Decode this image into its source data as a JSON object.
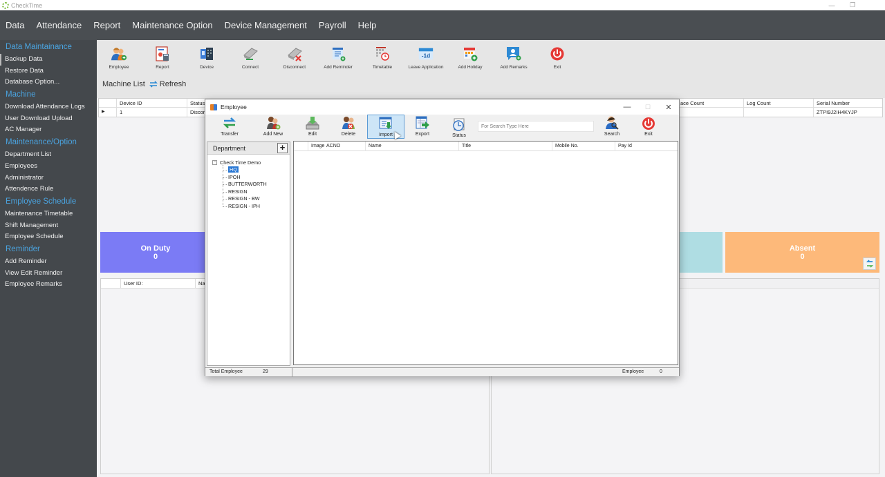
{
  "window": {
    "app_title": "CheckTime",
    "controls": {
      "minimize": "—",
      "restore": "❐",
      "close": "✕"
    }
  },
  "menu": [
    "Data",
    "Attendance",
    "Report",
    "Maintenance Option",
    "Device Management",
    "Payroll",
    "Help"
  ],
  "sidebar": [
    {
      "type": "section",
      "label": "Data Maintainance"
    },
    {
      "type": "item",
      "label": "Backup Data",
      "active": true
    },
    {
      "type": "item",
      "label": "Restore Data"
    },
    {
      "type": "item",
      "label": "Database Option..."
    },
    {
      "type": "section",
      "label": "Machine"
    },
    {
      "type": "item",
      "label": "Download Attendance Logs"
    },
    {
      "type": "item",
      "label": "User Download Upload"
    },
    {
      "type": "item",
      "label": "AC Manager"
    },
    {
      "type": "section",
      "label": "Maintenance/Option"
    },
    {
      "type": "item",
      "label": "Department List"
    },
    {
      "type": "item",
      "label": "Employees"
    },
    {
      "type": "item",
      "label": "Administrator"
    },
    {
      "type": "item",
      "label": "Attendence Rule"
    },
    {
      "type": "section",
      "label": "Employee Schedule"
    },
    {
      "type": "item",
      "label": "Maintenance Timetable"
    },
    {
      "type": "item",
      "label": "Shift Management"
    },
    {
      "type": "item",
      "label": "Employee Schedule"
    },
    {
      "type": "section",
      "label": "Reminder"
    },
    {
      "type": "item",
      "label": "Add Reminder"
    },
    {
      "type": "item",
      "label": "View Edit Reminder"
    },
    {
      "type": "item",
      "label": "Employee Remarks"
    }
  ],
  "ribbon": {
    "buttons": [
      {
        "label": "Employee",
        "icon": "employee-icon"
      },
      {
        "label": "Report",
        "icon": "report-icon"
      },
      {
        "label": "Device",
        "icon": "device-icon"
      },
      {
        "label": "Connect",
        "icon": "connect-icon"
      },
      {
        "label": "Disconnect",
        "icon": "disconnect-icon"
      },
      {
        "label": "Add Reminder",
        "icon": "add-reminder-icon"
      },
      {
        "label": "Timetable",
        "icon": "timetable-icon"
      },
      {
        "label": "Leave Application",
        "icon": "leave-application-icon",
        "glyph": "-1d"
      },
      {
        "label": "Add Holiday",
        "icon": "add-holiday-icon"
      },
      {
        "label": "Add Remarks",
        "icon": "add-remarks-icon"
      },
      {
        "label": "Exit",
        "icon": "exit-icon"
      }
    ],
    "machine_list_label": "Machine List",
    "refresh_label": "Refresh"
  },
  "machine_grid": {
    "columns": [
      "Device ID",
      "Status",
      "Face Count",
      "Log Count",
      "Serial Number"
    ],
    "visible_headers": {
      "device_id": "Device ID",
      "status": "Status",
      "face_count": "ace Count",
      "log_count": "Log Count",
      "serial": "Serial Number"
    },
    "rows": [
      {
        "device_id": "1",
        "status": "Disconn",
        "face_count": "",
        "log_count": "",
        "serial": "ZTPI9J2IH4KYJP"
      }
    ]
  },
  "tiles": [
    {
      "label": "On Duty",
      "value": "0",
      "color": "#7b7bf5"
    },
    {
      "label": "",
      "value": "",
      "color": "#afdde3"
    },
    {
      "label": "Absent",
      "value": "0",
      "color": "#fdb97a"
    }
  ],
  "bottom_left_panel": {
    "columns": [
      "User ID:",
      "Nam"
    ]
  },
  "dialog": {
    "title": "Employee",
    "toolbar": [
      {
        "label": "Transfer",
        "icon": "transfer-icon"
      },
      {
        "label": "Add New",
        "icon": "add-new-icon"
      },
      {
        "label": "Edit",
        "icon": "edit-icon"
      },
      {
        "label": "Delete",
        "icon": "delete-icon"
      },
      {
        "label": "Import",
        "icon": "import-icon",
        "active": true
      },
      {
        "label": "Export",
        "icon": "export-icon"
      },
      {
        "label": "Status",
        "icon": "status-icon"
      }
    ],
    "search_placeholder": "For Search Type Here",
    "search_label": "Search",
    "exit_label": "Exit",
    "department_label": "Department",
    "add_department": "+",
    "tree": {
      "root": "Check Time Demo",
      "expander": "⊟",
      "children": [
        {
          "label": "HQ",
          "selected": true
        },
        {
          "label": "IPOH"
        },
        {
          "label": "BUTTERWORTH"
        },
        {
          "label": "RESIGN"
        },
        {
          "label": "RESIGN - BW"
        },
        {
          "label": "RESIGN - IPH"
        }
      ]
    },
    "grid_columns": [
      "Image",
      "ACNO",
      "Name",
      "Title",
      "Mobile No.",
      "Pay Id"
    ],
    "status": {
      "total_label": "Total Employee",
      "total_value": "29",
      "employee_label": "Employee",
      "employee_value": "0"
    }
  }
}
